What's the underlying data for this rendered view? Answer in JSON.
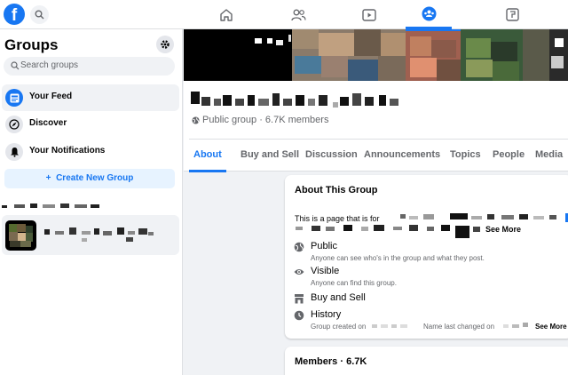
{
  "topbar": {
    "logo_letter": "f",
    "nav": [
      {
        "name": "home-icon",
        "active": false
      },
      {
        "name": "friends-icon",
        "active": false
      },
      {
        "name": "watch-icon",
        "active": false
      },
      {
        "name": "groups-icon",
        "active": true
      },
      {
        "name": "gaming-icon",
        "active": false
      }
    ],
    "accent_color": "#1877f2"
  },
  "sidebar": {
    "title": "Groups",
    "search_placeholder": "Search groups",
    "items": [
      {
        "label": "Your Feed",
        "icon": "feed-icon",
        "active": true
      },
      {
        "label": "Discover",
        "icon": "compass-icon",
        "active": false
      },
      {
        "label": "Your Notifications",
        "icon": "bell-icon",
        "active": false
      }
    ],
    "create_label": "Create New Group",
    "create_prefix": "+"
  },
  "group": {
    "meta": "Public group · 6.7K members"
  },
  "tabs": [
    {
      "label": "About",
      "active": true
    },
    {
      "label": "Buy and Sell",
      "active": false
    },
    {
      "label": "Discussion",
      "active": false
    },
    {
      "label": "Announcements",
      "active": false
    },
    {
      "label": "Topics",
      "active": false
    },
    {
      "label": "People",
      "active": false
    },
    {
      "label": "Media",
      "active": false
    }
  ],
  "about": {
    "title": "About This Group",
    "desc_prefix": "This is a page that is for",
    "see_more": "See More",
    "rows": [
      {
        "title": "Public",
        "sub": "Anyone can see who's in the group and what they post.",
        "icon": "globe-icon"
      },
      {
        "title": "Visible",
        "sub": "Anyone can find this group.",
        "icon": "eye-icon"
      },
      {
        "title": "Buy and Sell",
        "sub": "",
        "icon": "shop-icon"
      },
      {
        "title": "History",
        "sub_a": "Group created on",
        "sub_b": "Name last changed on",
        "see_more": "See More",
        "icon": "clock-icon"
      }
    ]
  },
  "members": {
    "title": "Members · 6.7K"
  }
}
